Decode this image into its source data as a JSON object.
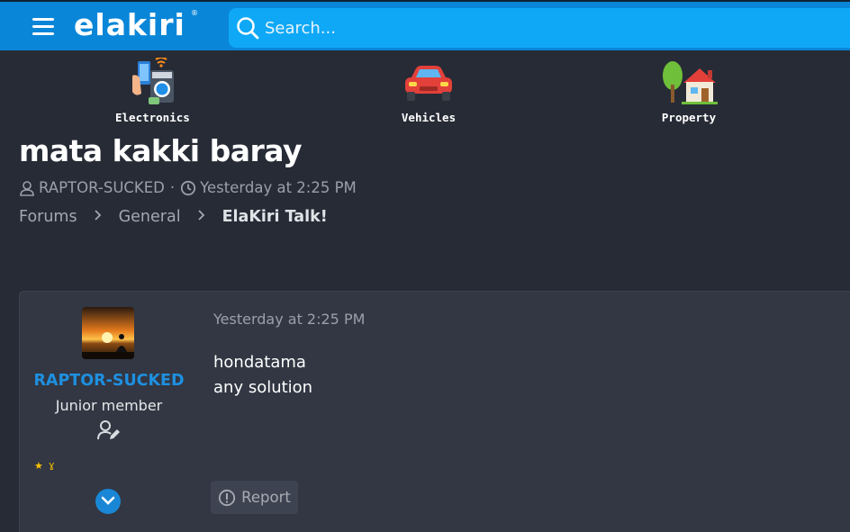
{
  "header": {
    "logo_text": "elakiri",
    "logo_mark": "®",
    "search_placeholder": "Search...",
    "brand_color": "#0a86d8"
  },
  "categories": [
    {
      "label": "Electronics",
      "icon": "electronics-icon"
    },
    {
      "label": "Vehicles",
      "icon": "car-icon"
    },
    {
      "label": "Property",
      "icon": "house-icon"
    }
  ],
  "thread": {
    "title": "mata kakki baray",
    "author": "RAPTOR-SUCKED",
    "separator": "·",
    "date": "Yesterday at 2:25 PM"
  },
  "breadcrumb": [
    {
      "label": "Forums"
    },
    {
      "label": "General"
    },
    {
      "label": "ElaKiri Talk!"
    }
  ],
  "post": {
    "username": "RAPTOR-SUCKED",
    "user_title": "Junior member",
    "date": "Yesterday at 2:25 PM",
    "lines": [
      "hondatama",
      "any solution"
    ],
    "report_label": "Report"
  }
}
